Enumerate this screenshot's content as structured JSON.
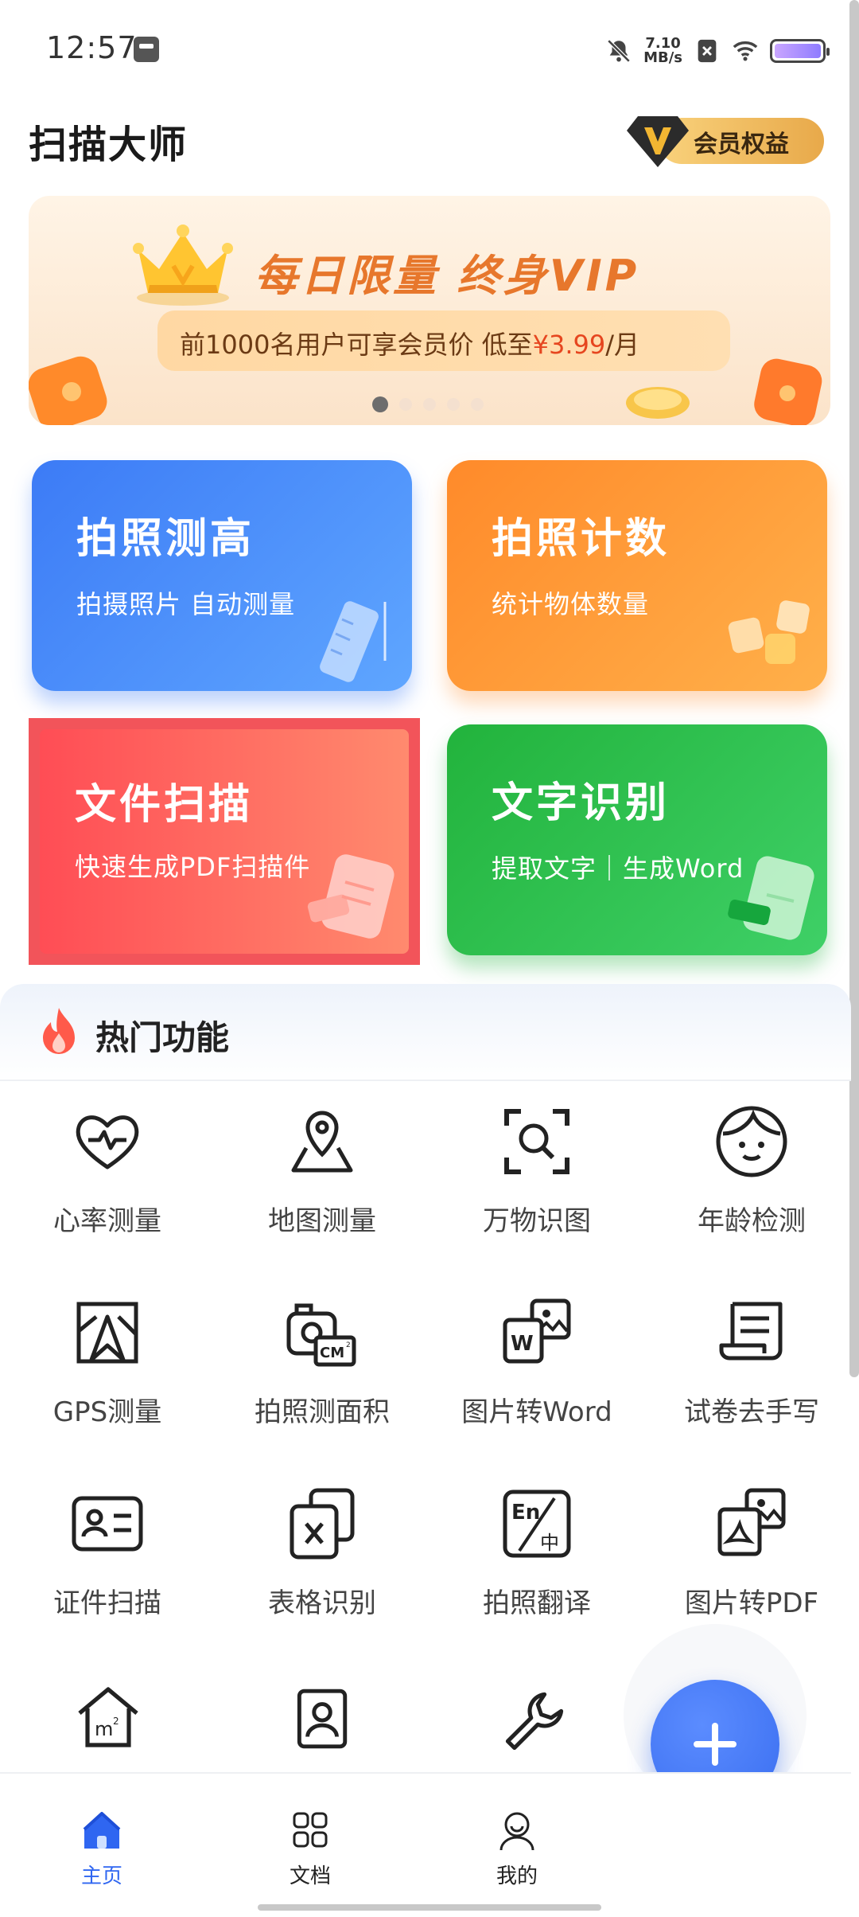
{
  "status_bar": {
    "time": "12:57",
    "net_speed_value": "7.10",
    "net_speed_unit": "MB/s"
  },
  "header": {
    "title": "扫描大师",
    "vip_label": "会员权益"
  },
  "banner": {
    "headline": "每日限量  终身VIP",
    "sub_prefix": "前1000名用户可享会员价 低至",
    "sub_price": "¥3.99",
    "sub_suffix": "/月"
  },
  "cards": {
    "measure": {
      "title": "拍照测高",
      "subtitle": "拍摄照片 自动测量"
    },
    "count": {
      "title": "拍照计数",
      "subtitle": "统计物体数量"
    },
    "scan": {
      "title": "文件扫描",
      "subtitle": "快速生成PDF扫描件"
    },
    "ocr": {
      "title": "文字识别",
      "subtitle": "提取文字｜生成Word"
    }
  },
  "hot": {
    "title": "热门功能",
    "items": [
      {
        "label": "心率测量",
        "icon": "heart-rate-icon"
      },
      {
        "label": "地图测量",
        "icon": "map-pin-icon"
      },
      {
        "label": "万物识图",
        "icon": "image-search-icon"
      },
      {
        "label": "年龄检测",
        "icon": "face-icon"
      },
      {
        "label": "GPS测量",
        "icon": "gps-map-icon"
      },
      {
        "label": "拍照测面积",
        "icon": "camera-area-icon"
      },
      {
        "label": "图片转Word",
        "icon": "image-to-word-icon"
      },
      {
        "label": "试卷去手写",
        "icon": "paper-scroll-icon"
      },
      {
        "label": "证件扫描",
        "icon": "id-card-icon"
      },
      {
        "label": "表格识别",
        "icon": "spreadsheet-icon"
      },
      {
        "label": "拍照翻译",
        "icon": "translate-icon"
      },
      {
        "label": "图片转PDF",
        "icon": "image-to-pdf-icon"
      }
    ]
  },
  "nav": {
    "home": "主页",
    "docs": "文档",
    "mine": "我的"
  },
  "colors": {
    "accent": "#2f66f1",
    "vip_gold": "#e8a94a",
    "banner_orange": "#e7772c"
  }
}
